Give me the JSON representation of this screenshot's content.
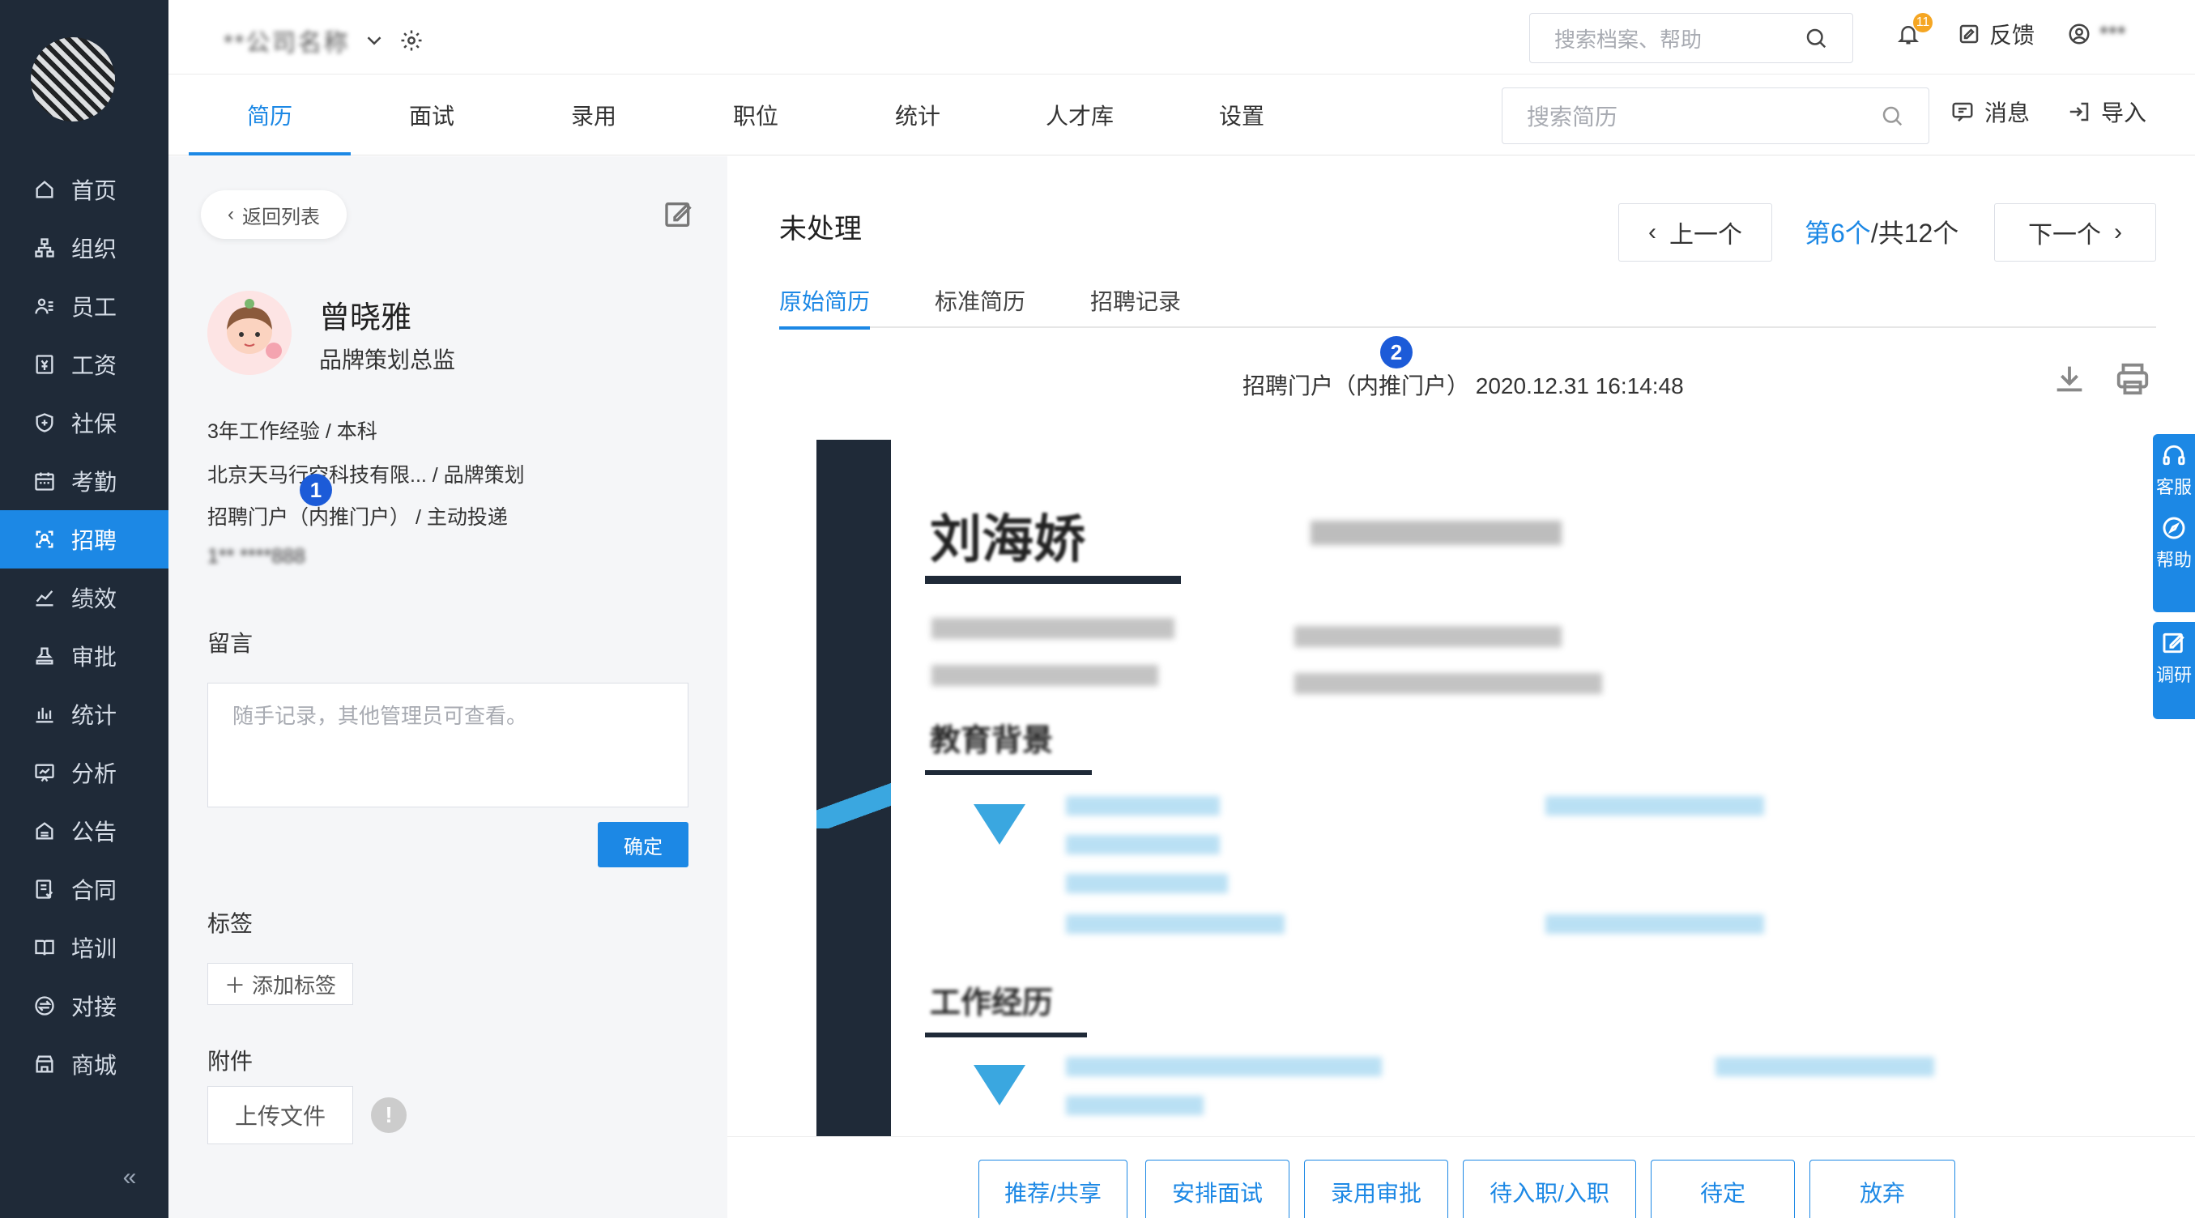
{
  "sidebar": {
    "items": [
      {
        "label": "首页",
        "icon": "home-icon"
      },
      {
        "label": "组织",
        "icon": "org-icon"
      },
      {
        "label": "员工",
        "icon": "employee-icon"
      },
      {
        "label": "工资",
        "icon": "salary-icon"
      },
      {
        "label": "社保",
        "icon": "shield-icon"
      },
      {
        "label": "考勤",
        "icon": "calendar-icon"
      },
      {
        "label": "招聘",
        "icon": "recruit-icon",
        "active": true
      },
      {
        "label": "绩效",
        "icon": "trend-icon"
      },
      {
        "label": "审批",
        "icon": "stamp-icon"
      },
      {
        "label": "统计",
        "icon": "bar-chart-icon"
      },
      {
        "label": "分析",
        "icon": "analysis-icon"
      },
      {
        "label": "公告",
        "icon": "notice-icon"
      },
      {
        "label": "合同",
        "icon": "contract-icon"
      },
      {
        "label": "培训",
        "icon": "training-icon"
      },
      {
        "label": "对接",
        "icon": "connect-icon"
      },
      {
        "label": "商城",
        "icon": "shop-icon"
      }
    ],
    "collapse_glyph": "«"
  },
  "topbar": {
    "company_name": "**公司名称",
    "search_placeholder": "搜索档案、帮助",
    "notification_count": "11",
    "feedback_label": "反馈",
    "user_name": "***"
  },
  "tabs": {
    "items": [
      "简历",
      "面试",
      "录用",
      "职位",
      "统计",
      "人才库",
      "设置"
    ],
    "search_placeholder": "搜索简历",
    "message_label": "消息",
    "import_label": "导入"
  },
  "profile": {
    "back_label": "返回列表",
    "name": "曾晓雅",
    "position": "品牌策划总监",
    "experience": "3年工作经验 / 本科",
    "company": "北京天马行空科技有限...   / 品牌策划",
    "source": "招聘门户（内推门户） / 主动投递",
    "phone_masked": "1**  ****888",
    "note_title": "留言",
    "note_placeholder": "随手记录，其他管理员可查看。",
    "confirm_label": "确定",
    "tag_title": "标签",
    "add_tag_label": "添加标签",
    "attachment_title": "附件",
    "upload_label": "上传文件",
    "info_glyph": "!"
  },
  "markers": {
    "m1": "1",
    "m2": "2"
  },
  "content": {
    "status": "未处理",
    "prev_label": "上一个",
    "next_label": "下一个",
    "pager_current": "第6个",
    "pager_total": "/共12个",
    "subtabs": [
      "原始简历",
      "标准简历",
      "招聘记录"
    ],
    "source_line": "招聘门户（内推门户）  2020.12.31 16:14:48"
  },
  "resume": {
    "name": "刘海娇",
    "edu_heading": "教育背景",
    "exp_heading": "工作经历"
  },
  "actions": [
    "推荐/共享",
    "安排面试",
    "录用审批",
    "待入职/入职",
    "待定",
    "放弃"
  ],
  "float": [
    "客服",
    "帮助",
    "调研"
  ],
  "colors": {
    "accent": "#1c88e5",
    "sidebar": "#1f2a38",
    "badge": "#f5a623"
  }
}
